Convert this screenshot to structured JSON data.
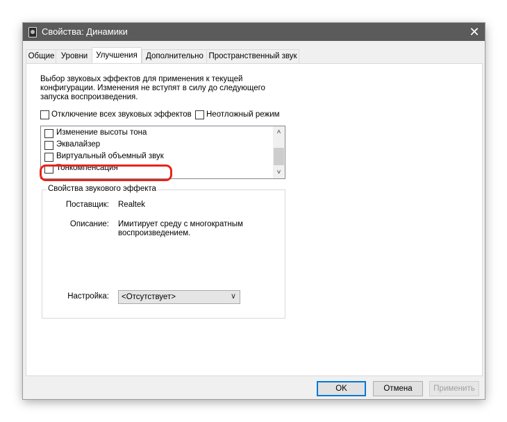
{
  "window": {
    "title": "Свойства: Динамики",
    "close_label": "✕"
  },
  "tabs": [
    {
      "label": "Общие"
    },
    {
      "label": "Уровни"
    },
    {
      "label": "Улучшения",
      "active": true
    },
    {
      "label": "Дополнительно"
    },
    {
      "label": "Пространственный звук"
    }
  ],
  "enhancements": {
    "description_lines": [
      "Выбор звуковых эффектов для применения к текущей",
      "конфигурации. Изменения не вступят в силу до следующего",
      "запуска воспроизведения."
    ],
    "disable_all": {
      "label": "Отключение всех звуковых эффектов",
      "checked": false
    },
    "immediate_mode": {
      "label": "Неотложный режим",
      "checked": false
    },
    "effects": [
      {
        "label": "Изменение высоты тона",
        "checked": false
      },
      {
        "label": "Эквалайзер",
        "checked": false
      },
      {
        "label": "Виртуальный объемный звук",
        "checked": false
      },
      {
        "label": "Тонкомпенсация",
        "checked": false
      }
    ],
    "highlighted_effect": "Тонкомпенсация",
    "highlight_color": "#e8231a"
  },
  "properties": {
    "group_title": "Свойства звукового эффекта",
    "provider_label": "Поставщик:",
    "provider_value": "Realtek",
    "description_label": "Описание:",
    "description_lines": [
      "Имитирует среду с многократным",
      "воспроизведением."
    ],
    "setting_label": "Настройка:",
    "setting_value": "<Отсутствует>"
  },
  "buttons": {
    "ok": "OK",
    "cancel": "Отмена",
    "apply": "Применить"
  },
  "colors": {
    "titlebar": "#5b5b5b",
    "default_button_border": "#0078d7"
  }
}
